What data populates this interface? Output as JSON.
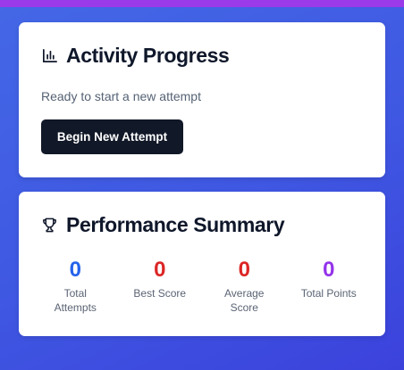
{
  "activity": {
    "title": "Activity Progress",
    "icon": "bar-chart-icon",
    "status": "Ready to start a new attempt",
    "begin_button": "Begin New Attempt"
  },
  "summary": {
    "title": "Performance Summary",
    "icon": "trophy-icon",
    "stats": [
      {
        "value": "0",
        "label": "Total Attempts",
        "color": "#2563eb"
      },
      {
        "value": "0",
        "label": "Best Score",
        "color": "#dc2626"
      },
      {
        "value": "0",
        "label": "Average Score",
        "color": "#dc2626"
      },
      {
        "value": "0",
        "label": "Total Points",
        "color": "#9333ea"
      }
    ]
  },
  "colors": {
    "background_gradient_start": "#4468e6",
    "background_gradient_end": "#3b42dc",
    "top_strip": "#9a3ae8",
    "button": "#111827"
  }
}
